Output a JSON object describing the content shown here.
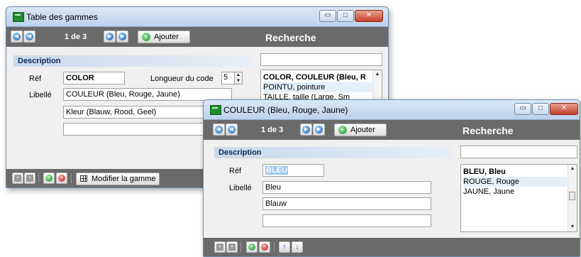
{
  "window1": {
    "title": "Table des gammes",
    "title_buttons": {
      "minimize": "▭",
      "maximize": "□",
      "close": "✕"
    },
    "toolbar": {
      "counter": "1 de 3",
      "add_label": "Ajouter",
      "search_header": "Recherche"
    },
    "section_title": "Description",
    "ref_label": "Réf",
    "ref_value": "COLOR",
    "code_length_label": "Longueur du code",
    "code_length_value": "5",
    "libelle_label": "Libellé",
    "libelle_value": "COULEUR (Bleu, Rouge, Jaune)",
    "libelle_translation_1": "Kleur (Blauw, Rood, Geel)",
    "libelle_translation_2": "",
    "search_value": "",
    "list_items": [
      "COLOR, COULEUR (Bleu, R",
      "POINTU, pointure",
      "TAILLE, taille (Large, Sm"
    ],
    "footer": {
      "modify_label": "Modifier la gamme"
    }
  },
  "window2": {
    "title": "COULEUR (Bleu, Rouge, Jaune)",
    "title_buttons": {
      "minimize": "▭",
      "maximize": "□",
      "close": "✕"
    },
    "toolbar": {
      "counter": "1 de 3",
      "add_label": "Ajouter",
      "search_header": "Recherche"
    },
    "section_title": "Description",
    "ref_label": "Réf",
    "ref_value": "BLEU",
    "libelle_label": "Libellé",
    "libelle_value": "Bleu",
    "libelle_translation_1": "Blauw",
    "libelle_translation_2": "",
    "search_value": "",
    "list_items": [
      "BLEU, Bleu",
      "ROUGE, Rouge",
      "JAUNE, Jaune"
    ]
  },
  "icons": {
    "first": "◀",
    "prev": "◀",
    "next": "▶",
    "last": "▶",
    "add": "+",
    "save": "▪",
    "cancel": "×",
    "up": "↑",
    "down": "↓",
    "scroll_up": "▲",
    "scroll_down": "▼",
    "spin_up": "▲",
    "spin_down": "▼"
  },
  "colors": {
    "toolbar_bg": "#6a6a6a",
    "section_bg": "#c9d9ea",
    "title_bg": "#bcd2ec",
    "close_bg": "#c5412c",
    "selection": "#99c6ef"
  }
}
